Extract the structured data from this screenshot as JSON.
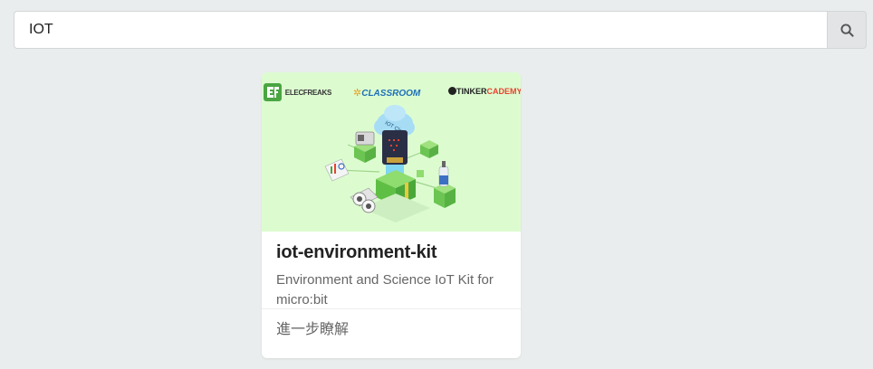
{
  "search": {
    "value": "IOT",
    "placeholder": ""
  },
  "icons": {
    "search_button": "search-icon"
  },
  "card": {
    "image_brands": {
      "elecfreaks": "ELECFREAKS",
      "classroom": "CLASSROOM",
      "tinkercademy": "TINKERCADEMY",
      "cloud_label": "IOT Cloud"
    },
    "title": "iot-environment-kit",
    "description": "Environment and Science IoT Kit for micro:bit",
    "footer_label": "進一步瞭解"
  },
  "colors": {
    "page_background": "#eaeded",
    "card_image_background": "#dcfcd0",
    "elecfreaks_green": "#4aa542",
    "classroom_blue": "#1e6fb8",
    "tinker_red": "#e8432e"
  }
}
